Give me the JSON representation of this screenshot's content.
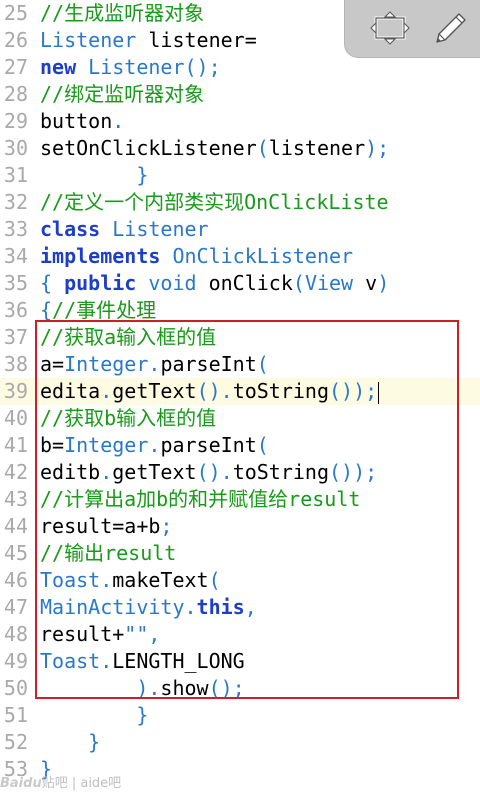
{
  "editor": {
    "lines": [
      {
        "n": "25",
        "parts": [
          {
            "t": "//生成监听器对象",
            "c": "comment"
          }
        ]
      },
      {
        "n": "26",
        "parts": [
          {
            "t": "Listener",
            "c": "type"
          },
          {
            "t": " listener=",
            "c": "plain"
          }
        ]
      },
      {
        "n": "27",
        "parts": [
          {
            "t": "new",
            "c": "keyword"
          },
          {
            "t": " ",
            "c": "plain"
          },
          {
            "t": "Listener",
            "c": "type"
          },
          {
            "t": "();",
            "c": "punct"
          }
        ]
      },
      {
        "n": "28",
        "parts": [
          {
            "t": "//绑定监听器对象",
            "c": "comment"
          }
        ]
      },
      {
        "n": "29",
        "parts": [
          {
            "t": "button",
            "c": "plain"
          },
          {
            "t": ".",
            "c": "punct"
          }
        ]
      },
      {
        "n": "30",
        "parts": [
          {
            "t": "setOnClickListener",
            "c": "plain"
          },
          {
            "t": "(",
            "c": "punct"
          },
          {
            "t": "listener",
            "c": "plain"
          },
          {
            "t": ");",
            "c": "punct"
          }
        ]
      },
      {
        "n": "31",
        "parts": [
          {
            "t": "        }",
            "c": "punct"
          }
        ]
      },
      {
        "n": "32",
        "parts": [
          {
            "t": "//定义一个内部类实现OnClickListe",
            "c": "comment"
          }
        ]
      },
      {
        "n": "33",
        "parts": [
          {
            "t": "class",
            "c": "keyword"
          },
          {
            "t": " ",
            "c": "plain"
          },
          {
            "t": "Listener",
            "c": "type"
          }
        ]
      },
      {
        "n": "34",
        "parts": [
          {
            "t": "implements",
            "c": "keyword"
          },
          {
            "t": " ",
            "c": "plain"
          },
          {
            "t": "OnClickListener",
            "c": "type"
          }
        ]
      },
      {
        "n": "35",
        "parts": [
          {
            "t": "{ ",
            "c": "punct"
          },
          {
            "t": "public",
            "c": "keyword"
          },
          {
            "t": " ",
            "c": "plain"
          },
          {
            "t": "void",
            "c": "type"
          },
          {
            "t": " onClick",
            "c": "plain"
          },
          {
            "t": "(",
            "c": "punct"
          },
          {
            "t": "View",
            "c": "type"
          },
          {
            "t": " v",
            "c": "plain"
          },
          {
            "t": ")",
            "c": "punct"
          }
        ]
      },
      {
        "n": "36",
        "parts": [
          {
            "t": "{",
            "c": "punct"
          },
          {
            "t": "//事件处理",
            "c": "comment"
          }
        ]
      },
      {
        "n": "37",
        "parts": [
          {
            "t": "//获取a输入框的值",
            "c": "comment"
          }
        ]
      },
      {
        "n": "38",
        "parts": [
          {
            "t": "a=",
            "c": "plain"
          },
          {
            "t": "Integer",
            "c": "type"
          },
          {
            "t": ".",
            "c": "punct"
          },
          {
            "t": "parseInt",
            "c": "plain"
          },
          {
            "t": "(",
            "c": "punct"
          }
        ]
      },
      {
        "n": "39",
        "parts": [
          {
            "t": "edita",
            "c": "plain"
          },
          {
            "t": ".",
            "c": "punct"
          },
          {
            "t": "getText",
            "c": "plain"
          },
          {
            "t": "().",
            "c": "punct"
          },
          {
            "t": "toString",
            "c": "plain"
          },
          {
            "t": "());",
            "c": "punct"
          }
        ],
        "current": true
      },
      {
        "n": "40",
        "parts": [
          {
            "t": "//获取b输入框的值",
            "c": "comment"
          }
        ]
      },
      {
        "n": "41",
        "parts": [
          {
            "t": "b=",
            "c": "plain"
          },
          {
            "t": "Integer",
            "c": "type"
          },
          {
            "t": ".",
            "c": "punct"
          },
          {
            "t": "parseInt",
            "c": "plain"
          },
          {
            "t": "(",
            "c": "punct"
          }
        ]
      },
      {
        "n": "42",
        "parts": [
          {
            "t": "editb",
            "c": "plain"
          },
          {
            "t": ".",
            "c": "punct"
          },
          {
            "t": "getText",
            "c": "plain"
          },
          {
            "t": "().",
            "c": "punct"
          },
          {
            "t": "toString",
            "c": "plain"
          },
          {
            "t": "());",
            "c": "punct"
          }
        ]
      },
      {
        "n": "43",
        "parts": [
          {
            "t": "//计算出a加b的和并赋值给result",
            "c": "comment"
          }
        ]
      },
      {
        "n": "44",
        "parts": [
          {
            "t": "result=a+b",
            "c": "plain"
          },
          {
            "t": ";",
            "c": "punct"
          }
        ]
      },
      {
        "n": "45",
        "parts": [
          {
            "t": "//输出result",
            "c": "comment"
          }
        ]
      },
      {
        "n": "46",
        "parts": [
          {
            "t": "Toast",
            "c": "type"
          },
          {
            "t": ".",
            "c": "punct"
          },
          {
            "t": "makeText",
            "c": "plain"
          },
          {
            "t": "(",
            "c": "punct"
          }
        ]
      },
      {
        "n": "47",
        "parts": [
          {
            "t": "MainActivity",
            "c": "type"
          },
          {
            "t": ".",
            "c": "punct"
          },
          {
            "t": "this",
            "c": "keyword"
          },
          {
            "t": ",",
            "c": "punct"
          }
        ]
      },
      {
        "n": "48",
        "parts": [
          {
            "t": "result+",
            "c": "plain"
          },
          {
            "t": "\"\",",
            "c": "punct"
          }
        ]
      },
      {
        "n": "49",
        "parts": [
          {
            "t": "Toast",
            "c": "type"
          },
          {
            "t": ".",
            "c": "punct"
          },
          {
            "t": "LENGTH_LONG",
            "c": "plain"
          }
        ]
      },
      {
        "n": "50",
        "parts": [
          {
            "t": "        ).",
            "c": "punct"
          },
          {
            "t": "show",
            "c": "plain"
          },
          {
            "t": "();",
            "c": "punct"
          }
        ]
      },
      {
        "n": "51",
        "parts": [
          {
            "t": "        }",
            "c": "punct"
          }
        ]
      },
      {
        "n": "52",
        "parts": [
          {
            "t": "    }",
            "c": "punct"
          }
        ]
      },
      {
        "n": "53",
        "parts": [
          {
            "t": "}",
            "c": "punct"
          }
        ]
      }
    ]
  },
  "toolbar": {
    "buttons": [
      {
        "name": "fit-screen-icon"
      },
      {
        "name": "pencil-icon"
      }
    ]
  },
  "watermark": {
    "logo": "Bai",
    "logo2": "du",
    "text": "贴吧 | aide吧"
  },
  "colors": {
    "comment": "#1a9a1a",
    "keyword": "#1e3ec8",
    "type": "#2a78c9",
    "highlight_border": "#cc1f2a",
    "current_line": "#fdfbe2"
  }
}
